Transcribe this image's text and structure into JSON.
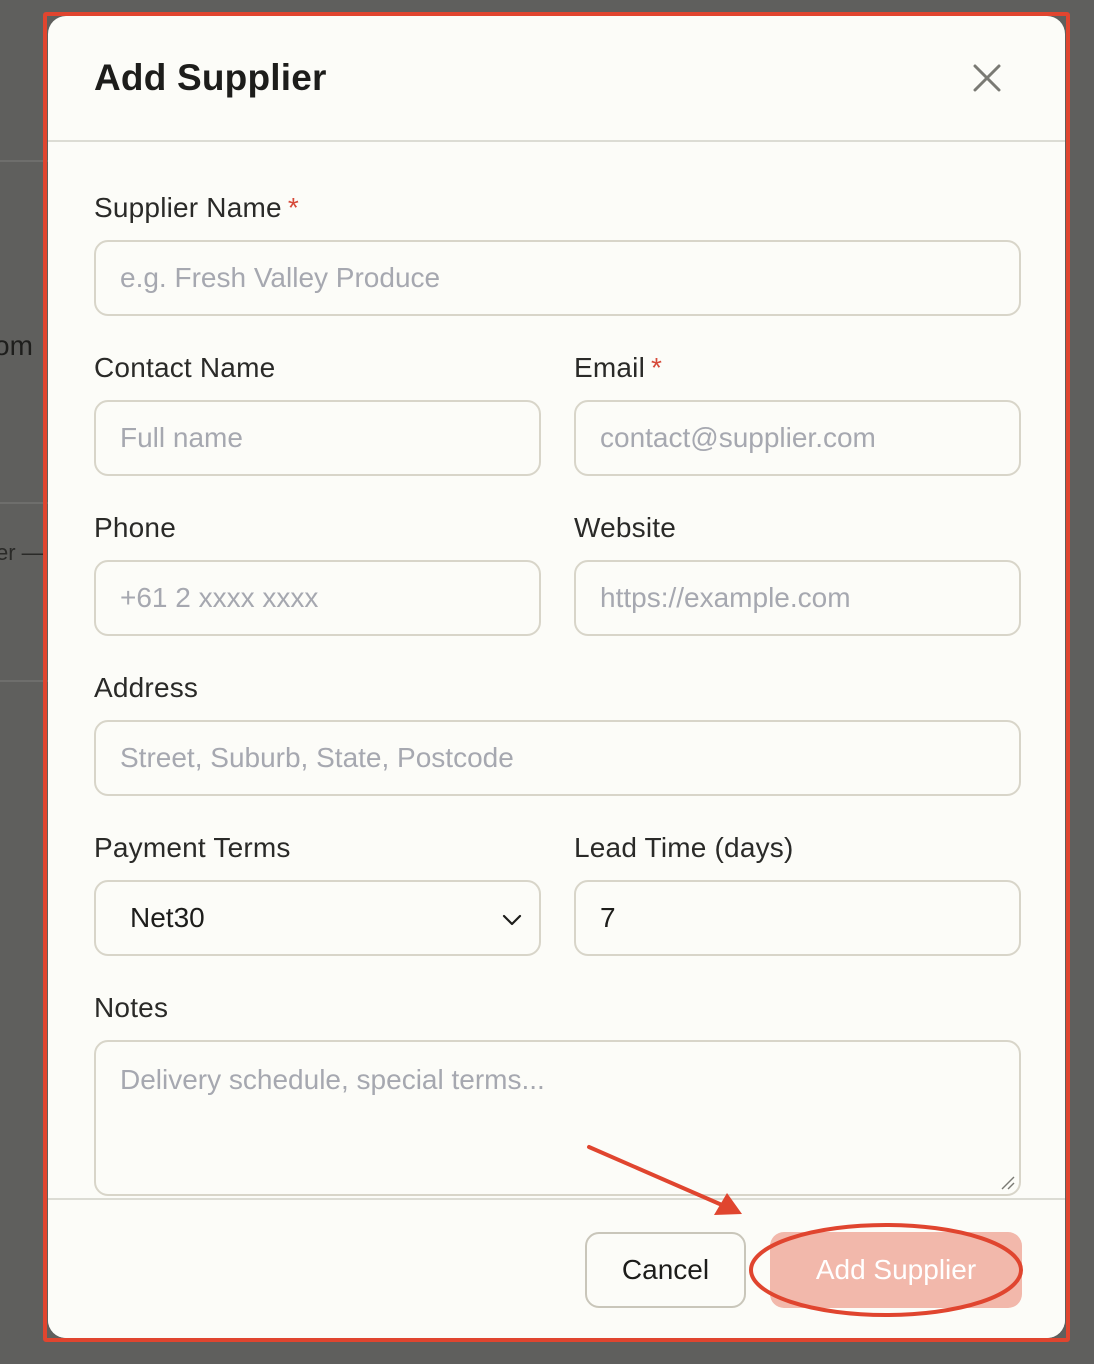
{
  "background": {
    "fragment_1": "om",
    "fragment_2": "er —"
  },
  "modal": {
    "title": "Add Supplier",
    "close_icon": "close-icon"
  },
  "form": {
    "supplier_name": {
      "label": "Supplier Name",
      "required": "*",
      "placeholder": "e.g. Fresh Valley Produce"
    },
    "contact_name": {
      "label": "Contact Name",
      "placeholder": "Full name"
    },
    "email": {
      "label": "Email",
      "required": "*",
      "placeholder": "contact@supplier.com"
    },
    "phone": {
      "label": "Phone",
      "placeholder": "+61 2 xxxx xxxx"
    },
    "website": {
      "label": "Website",
      "placeholder": "https://example.com"
    },
    "address": {
      "label": "Address",
      "placeholder": "Street, Suburb, State, Postcode"
    },
    "payment_terms": {
      "label": "Payment Terms",
      "value": "Net30"
    },
    "lead_time": {
      "label": "Lead Time (days)",
      "value": "7"
    },
    "notes": {
      "label": "Notes",
      "placeholder": "Delivery schedule, special terms..."
    }
  },
  "footer": {
    "cancel_label": "Cancel",
    "submit_label": "Add Supplier"
  },
  "colors": {
    "accent": "#f2b8ab",
    "annotation": "#e0452f",
    "required": "#d64a3a"
  }
}
